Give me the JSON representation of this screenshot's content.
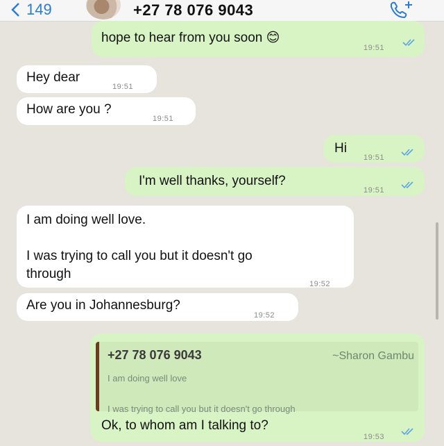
{
  "header": {
    "back_count": "149",
    "contact_name": "+27 78 076 9043",
    "back_icon": "chevron-left-icon",
    "call_icon": "phone-add-icon"
  },
  "messages": [
    {
      "dir": "out",
      "text": "hope to hear from you soon 😊",
      "time": "19:51",
      "ticks": true
    },
    {
      "dir": "in",
      "text": "Hey dear",
      "time": "19:51"
    },
    {
      "dir": "in",
      "text": "How are you ?",
      "time": "19:51"
    },
    {
      "dir": "out",
      "text": "Hi",
      "time": "19:51",
      "ticks": true
    },
    {
      "dir": "out",
      "text": "I'm well thanks, yourself?",
      "time": "19:51",
      "ticks": true
    },
    {
      "dir": "in",
      "text": "I am doing well love.\n\nI was trying to call you but it doesn't go\nthrough",
      "time": "19:52"
    },
    {
      "dir": "in",
      "text": "Are you in Johannesburg?",
      "time": "19:52"
    },
    {
      "dir": "out",
      "text": "Ok, to whom am I talking to?",
      "time": "19:53",
      "ticks": true,
      "quote": {
        "number": "+27 78 076 9043",
        "name": "~Sharon Gambu",
        "line1": "I am doing well love",
        "line2": "I was trying to call you but it doesn't go through"
      }
    }
  ],
  "colors": {
    "background": "#e7e3dd",
    "incoming_bubble": "#ffffff",
    "outgoing_bubble": "#d9f4c4",
    "accent": "#2a7bd6",
    "read_ticks": "#5aa5e4"
  }
}
